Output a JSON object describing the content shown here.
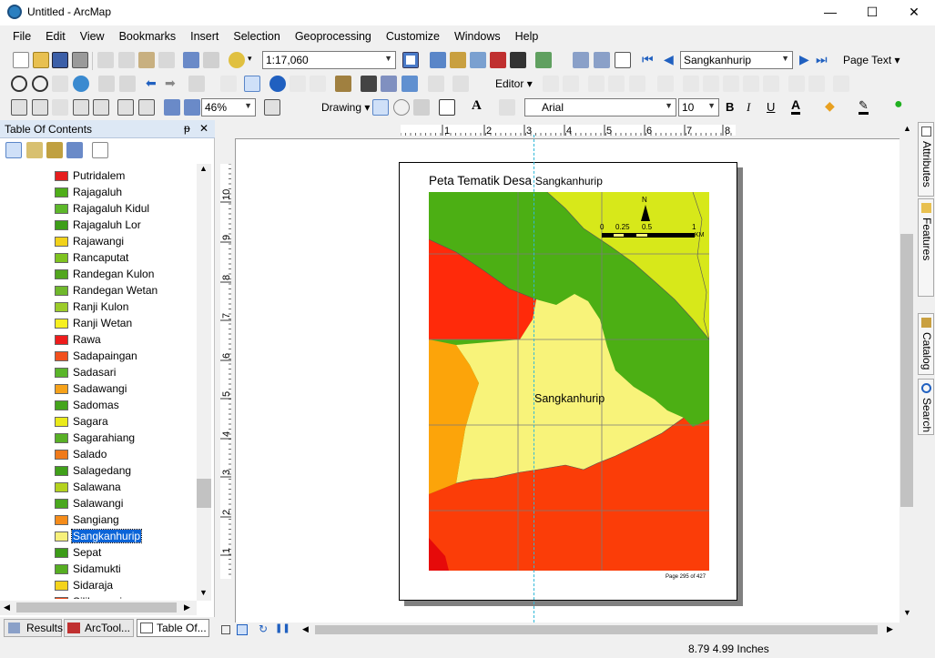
{
  "window": {
    "title": "Untitled - ArcMap",
    "minimize": "—",
    "maximize": "☐",
    "close": "✕"
  },
  "menu": [
    "File",
    "Edit",
    "View",
    "Bookmarks",
    "Insert",
    "Selection",
    "Geoprocessing",
    "Customize",
    "Windows",
    "Help"
  ],
  "toolbar": {
    "scale": "1:17,060",
    "page_field": "Sangkanhurip",
    "page_text": "Page Text",
    "editor": "Editor",
    "zoom_percent": "46%",
    "drawing": "Drawing",
    "font_name": "Arial",
    "font_size": "10",
    "bold": "B",
    "italic": "I",
    "underline": "U",
    "font_color_letter": "A"
  },
  "toc": {
    "title": "Table Of Contents",
    "pin": "ᵽ",
    "close": "✕",
    "items": [
      {
        "label": "Putridalem",
        "color": "#e61e1e"
      },
      {
        "label": "Rajagaluh",
        "color": "#4fae1a"
      },
      {
        "label": "Rajagaluh Kidul",
        "color": "#5db82a"
      },
      {
        "label": "Rajagaluh Lor",
        "color": "#3d9e18"
      },
      {
        "label": "Rajawangi",
        "color": "#f2d21a"
      },
      {
        "label": "Rancaputat",
        "color": "#7ec320"
      },
      {
        "label": "Randegan Kulon",
        "color": "#52a61e"
      },
      {
        "label": "Randegan Wetan",
        "color": "#6fb82c"
      },
      {
        "label": "Ranji Kulon",
        "color": "#9ccc2a"
      },
      {
        "label": "Ranji Wetan",
        "color": "#f7f020"
      },
      {
        "label": "Rawa",
        "color": "#ee1c1c"
      },
      {
        "label": "Sadapaingan",
        "color": "#f2501e"
      },
      {
        "label": "Sadasari",
        "color": "#5ab52a"
      },
      {
        "label": "Sadawangi",
        "color": "#f6a21a"
      },
      {
        "label": "Sadomas",
        "color": "#44a41c"
      },
      {
        "label": "Sagara",
        "color": "#eaea1a"
      },
      {
        "label": "Sagarahiang",
        "color": "#58b026"
      },
      {
        "label": "Salado",
        "color": "#f07a1a"
      },
      {
        "label": "Salagedang",
        "color": "#40a01a"
      },
      {
        "label": "Salawana",
        "color": "#b4d21e"
      },
      {
        "label": "Salawangi",
        "color": "#4aa81e"
      },
      {
        "label": "Sangiang",
        "color": "#f58c1a"
      },
      {
        "label": "Sangkanhurip",
        "color": "#f7f07a",
        "selected": true
      },
      {
        "label": "Sepat",
        "color": "#3c9c18"
      },
      {
        "label": "Sidamukti",
        "color": "#56ae22"
      },
      {
        "label": "Sidaraja",
        "color": "#f4d31c"
      },
      {
        "label": "Silihwangi",
        "color": "#ee4a18"
      }
    ]
  },
  "map": {
    "title": "Peta Tematik Desa",
    "title_name": "Sangkanhurip",
    "feature_label": "Sangkanhurip",
    "north": "N",
    "scale_labels": [
      "0",
      "0.25",
      "0.5",
      "1"
    ],
    "scale_unit": "KM",
    "page_note": "Page 295 of 427",
    "hruler_ticks": [
      "1",
      "2",
      "3",
      "4",
      "5",
      "6",
      "7",
      "8"
    ],
    "vruler_ticks": [
      "10",
      "9",
      "8",
      "7",
      "6",
      "5",
      "4",
      "3",
      "2",
      "1"
    ]
  },
  "side_tabs": [
    "Attributes",
    "Create Features",
    "Catalog",
    "Search"
  ],
  "bottom_tabs": [
    "Results",
    "ArcTool...",
    "Table Of..."
  ],
  "status": {
    "coords": "8.79  4.99 Inches"
  }
}
